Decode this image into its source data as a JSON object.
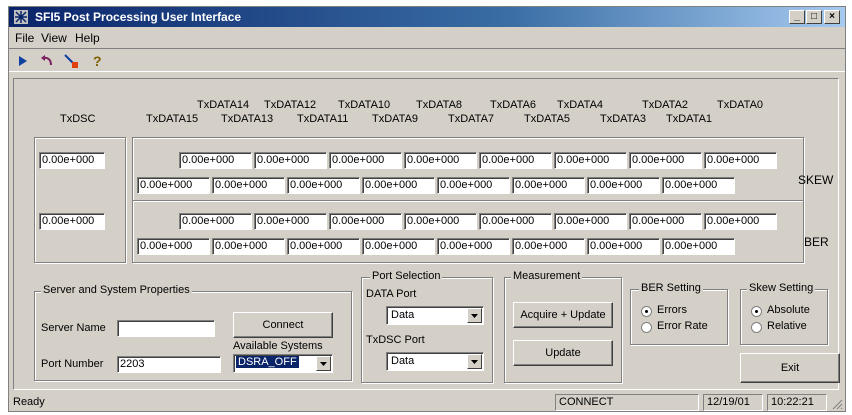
{
  "window": {
    "title": "SFI5 Post Processing User Interface",
    "min_label": "_",
    "max_label": "□",
    "close_label": "×"
  },
  "menu": {
    "file": "File",
    "view": "View",
    "help": "Help"
  },
  "toolbar": [
    "play-icon",
    "undo-icon",
    "stop-icon",
    "help-icon"
  ],
  "columns": {
    "txdsc": "TxDSC",
    "top_row": [
      "TxDATA14",
      "TxDATA12",
      "TxDATA10",
      "TxDATA8",
      "TxDATA6",
      "TxDATA4",
      "TxDATA2",
      "TxDATA0"
    ],
    "bottom_row": [
      "TxDATA15",
      "TxDATA13",
      "TxDATA11",
      "TxDATA9",
      "TxDATA7",
      "TxDATA5",
      "TxDATA3",
      "TxDATA1"
    ]
  },
  "skew": {
    "label": "SKEW",
    "txdsc": "0.00e+000",
    "even": [
      "0.00e+000",
      "0.00e+000",
      "0.00e+000",
      "0.00e+000",
      "0.00e+000",
      "0.00e+000",
      "0.00e+000",
      "0.00e+000"
    ],
    "odd": [
      "0.00e+000",
      "0.00e+000",
      "0.00e+000",
      "0.00e+000",
      "0.00e+000",
      "0.00e+000",
      "0.00e+000",
      "0.00e+000"
    ]
  },
  "ber": {
    "label": "BER",
    "txdsc": "0.00e+000",
    "even": [
      "0.00e+000",
      "0.00e+000",
      "0.00e+000",
      "0.00e+000",
      "0.00e+000",
      "0.00e+000",
      "0.00e+000",
      "0.00e+000"
    ],
    "odd": [
      "0.00e+000",
      "0.00e+000",
      "0.00e+000",
      "0.00e+000",
      "0.00e+000",
      "0.00e+000",
      "0.00e+000",
      "0.00e+000"
    ]
  },
  "server": {
    "title": "Server and System Properties",
    "name_label": "Server Name",
    "name_value": "",
    "port_label": "Port Number",
    "port_value": "2203",
    "connect": "Connect",
    "systems_label": "Available Systems",
    "systems_value": "DSRA_OFF"
  },
  "port_selection": {
    "title": "Port Selection",
    "data_label": "DATA Port",
    "data_value": "Data",
    "txdsc_label": "TxDSC Port",
    "txdsc_value": "Data"
  },
  "measurement": {
    "title": "Measurement",
    "acquire": "Acquire + Update",
    "update": "Update"
  },
  "ber_setting": {
    "title": "BER Setting",
    "options": [
      "Errors",
      "Error Rate"
    ],
    "selected": "Errors"
  },
  "skew_setting": {
    "title": "Skew Setting",
    "options": [
      "Absolute",
      "Relative"
    ],
    "selected": "Absolute"
  },
  "exit": "Exit",
  "statusbar": {
    "ready": "Ready",
    "connection": "CONNECT",
    "date": "12/19/01",
    "time": "10:22:21"
  }
}
